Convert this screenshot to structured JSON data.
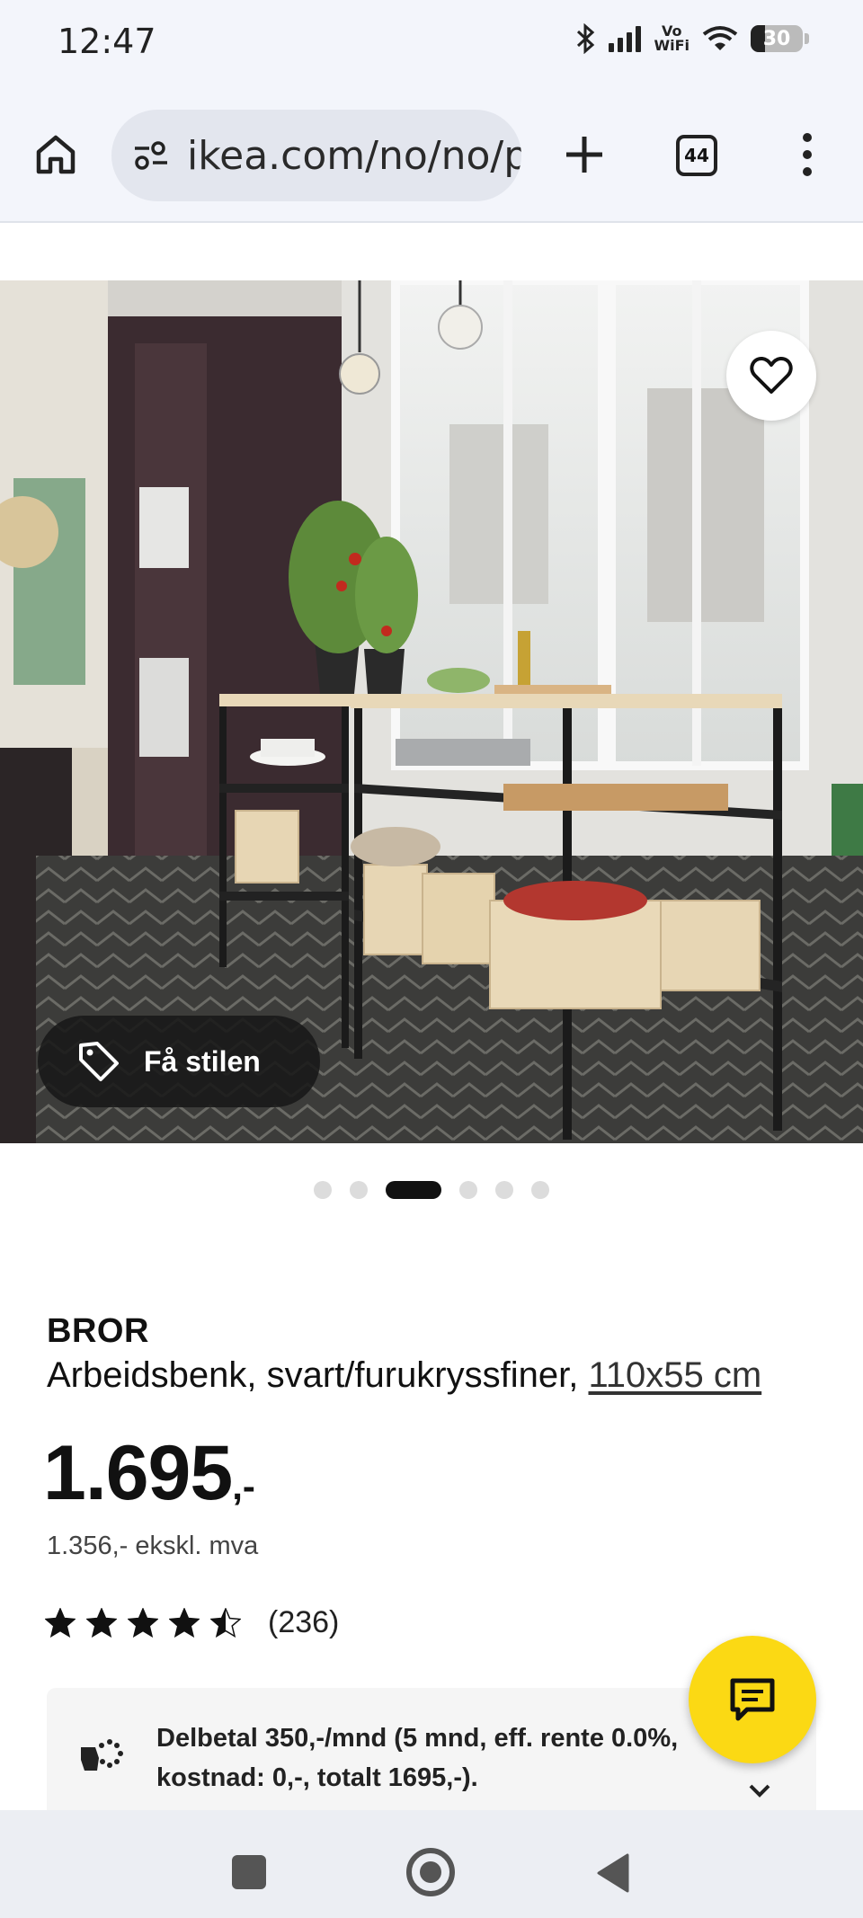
{
  "status_bar": {
    "time": "12:47",
    "vowifi_top": "Vo",
    "vowifi_bottom": "WiFi",
    "battery_level": "30",
    "icons": [
      "bluetooth-icon",
      "signal-icon",
      "vowifi-icon",
      "wifi-icon",
      "battery-icon"
    ]
  },
  "browser": {
    "url": "ikea.com/no/no/p",
    "tab_count": "44",
    "icons": [
      "home-icon",
      "site-settings-icon",
      "new-tab-plus-icon",
      "tabs-icon",
      "more-menu-icon"
    ]
  },
  "gallery": {
    "style_button_label": "Få stilen",
    "dot_count": 6,
    "active_dot": 2,
    "icons": [
      "heart-icon",
      "price-tag-icon"
    ]
  },
  "product": {
    "brand": "BROR",
    "description": "Arbeidsbenk, svart/furukryssfiner,",
    "size": "110x55 cm",
    "price": "1.695",
    "price_suffix": ",-",
    "price_ex_vat": "1.356,- ekskl. mva",
    "rating": 4.5,
    "rating_max": 5,
    "review_count": "(236)"
  },
  "installment": {
    "text": "Delbetal 350,-/mnd (5 mnd, eff. rente 0.0%, kostnad: 0,-, totalt 1695,-).",
    "icons": [
      "installment-icon",
      "chevron-down-icon"
    ]
  },
  "chat": {
    "icon": "chat-icon"
  },
  "colors": {
    "accent_yellow": "#fbd914",
    "text": "#111111",
    "chrome_bg": "#f3f5fb"
  }
}
